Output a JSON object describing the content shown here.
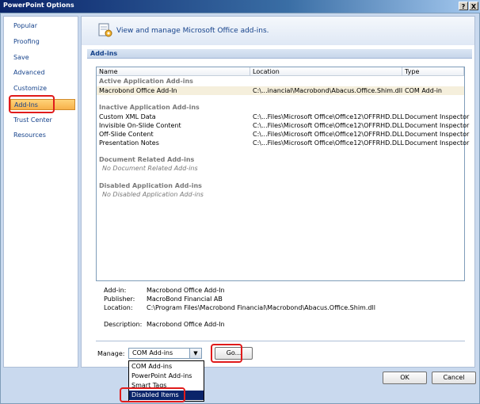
{
  "window": {
    "title": "PowerPoint Options",
    "help_label": "?",
    "close_label": "X"
  },
  "nav": {
    "items": [
      {
        "label": "Popular"
      },
      {
        "label": "Proofing"
      },
      {
        "label": "Save"
      },
      {
        "label": "Advanced"
      },
      {
        "label": "Customize"
      },
      {
        "label": "Add-Ins",
        "selected": true
      },
      {
        "label": "Trust Center"
      },
      {
        "label": "Resources"
      }
    ]
  },
  "header": {
    "icon": "addins-gear-icon",
    "text": "View and manage Microsoft Office add-ins."
  },
  "section": {
    "title": "Add-ins"
  },
  "table": {
    "columns": [
      "Name",
      "Location",
      "Type"
    ],
    "groups": [
      {
        "title": "Active Application Add-ins",
        "rows": [
          {
            "name": "Macrobond Office Add-In",
            "location": "C:\\...inancial\\Macrobond\\Abacus.Office.Shim.dll",
            "type": "COM Add-in",
            "selected": true
          }
        ]
      },
      {
        "title": "Inactive Application Add-ins",
        "rows": [
          {
            "name": "Custom XML Data",
            "location": "C:\\...Files\\Microsoft Office\\Office12\\OFFRHD.DLL",
            "type": "Document Inspector"
          },
          {
            "name": "Invisible On-Slide Content",
            "location": "C:\\...Files\\Microsoft Office\\Office12\\OFFRHD.DLL",
            "type": "Document Inspector"
          },
          {
            "name": "Off-Slide Content",
            "location": "C:\\...Files\\Microsoft Office\\Office12\\OFFRHD.DLL",
            "type": "Document Inspector"
          },
          {
            "name": "Presentation Notes",
            "location": "C:\\...Files\\Microsoft Office\\Office12\\OFFRHD.DLL",
            "type": "Document Inspector"
          }
        ]
      },
      {
        "title": "Document Related Add-ins",
        "empty": "No Document Related Add-ins"
      },
      {
        "title": "Disabled Application Add-ins",
        "empty": "No Disabled Application Add-ins"
      }
    ]
  },
  "details": {
    "addin_label": "Add-in:",
    "addin_value": "Macrobond Office Add-In",
    "publisher_label": "Publisher:",
    "publisher_value": "MacroBond Financial AB",
    "location_label": "Location:",
    "location_value": "C:\\Program Files\\Macrobond Financial\\Macrobond\\Abacus.Office.Shim.dll",
    "description_label": "Description:",
    "description_value": "Macrobond Office Add-In"
  },
  "manage": {
    "label": "Manage:",
    "selected": "COM Add-ins",
    "go_label": "Go...",
    "options": [
      "COM Add-ins",
      "PowerPoint Add-ins",
      "Smart Tags",
      "Disabled Items"
    ],
    "highlighted_option": "Disabled Items"
  },
  "footer": {
    "ok_label": "OK",
    "cancel_label": "Cancel"
  },
  "colors": {
    "title_bar": "#0a246a",
    "selected_nav": "#f7b14a",
    "annotation_red": "#e01b1b",
    "link_blue": "#15428b"
  }
}
